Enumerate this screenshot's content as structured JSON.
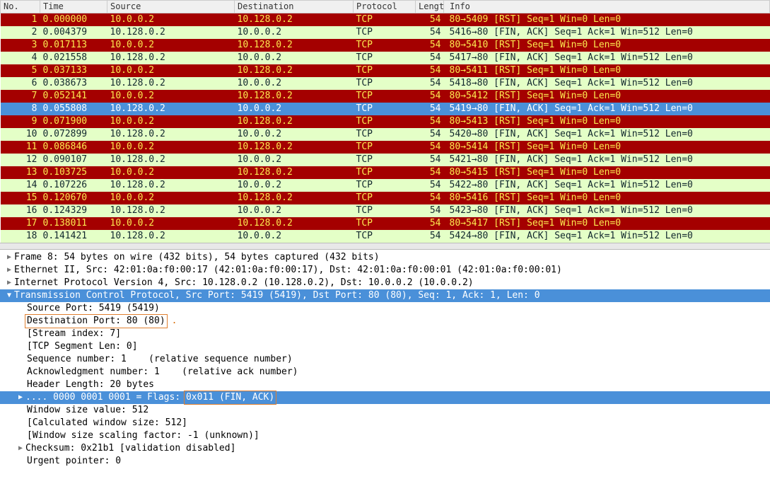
{
  "columns": {
    "no": "No.",
    "time": "Time",
    "src": "Source",
    "dst": "Destination",
    "proto": "Protocol",
    "len": "Length",
    "info": "Info"
  },
  "packets": [
    {
      "no": 1,
      "time": "0.000000",
      "src": "10.0.0.2",
      "dst": "10.128.0.2",
      "proto": "TCP",
      "len": 54,
      "info": "80→5409 [RST] Seq=1 Win=0 Len=0",
      "cls": "red"
    },
    {
      "no": 2,
      "time": "0.004379",
      "src": "10.128.0.2",
      "dst": "10.0.0.2",
      "proto": "TCP",
      "len": 54,
      "info": "5416→80 [FIN, ACK] Seq=1 Ack=1 Win=512 Len=0",
      "cls": "grn"
    },
    {
      "no": 3,
      "time": "0.017113",
      "src": "10.0.0.2",
      "dst": "10.128.0.2",
      "proto": "TCP",
      "len": 54,
      "info": "80→5410 [RST] Seq=1 Win=0 Len=0",
      "cls": "red"
    },
    {
      "no": 4,
      "time": "0.021558",
      "src": "10.128.0.2",
      "dst": "10.0.0.2",
      "proto": "TCP",
      "len": 54,
      "info": "5417→80 [FIN, ACK] Seq=1 Ack=1 Win=512 Len=0",
      "cls": "grn"
    },
    {
      "no": 5,
      "time": "0.037133",
      "src": "10.0.0.2",
      "dst": "10.128.0.2",
      "proto": "TCP",
      "len": 54,
      "info": "80→5411 [RST] Seq=1 Win=0 Len=0",
      "cls": "red"
    },
    {
      "no": 6,
      "time": "0.038673",
      "src": "10.128.0.2",
      "dst": "10.0.0.2",
      "proto": "TCP",
      "len": 54,
      "info": "5418→80 [FIN, ACK] Seq=1 Ack=1 Win=512 Len=0",
      "cls": "grn"
    },
    {
      "no": 7,
      "time": "0.052141",
      "src": "10.0.0.2",
      "dst": "10.128.0.2",
      "proto": "TCP",
      "len": 54,
      "info": "80→5412 [RST] Seq=1 Win=0 Len=0",
      "cls": "red"
    },
    {
      "no": 8,
      "time": "0.055808",
      "src": "10.128.0.2",
      "dst": "10.0.0.2",
      "proto": "TCP",
      "len": 54,
      "info": "5419→80 [FIN, ACK] Seq=1 Ack=1 Win=512 Len=0",
      "cls": "sel"
    },
    {
      "no": 9,
      "time": "0.071900",
      "src": "10.0.0.2",
      "dst": "10.128.0.2",
      "proto": "TCP",
      "len": 54,
      "info": "80→5413 [RST] Seq=1 Win=0 Len=0",
      "cls": "red"
    },
    {
      "no": 10,
      "time": "0.072899",
      "src": "10.128.0.2",
      "dst": "10.0.0.2",
      "proto": "TCP",
      "len": 54,
      "info": "5420→80 [FIN, ACK] Seq=1 Ack=1 Win=512 Len=0",
      "cls": "grn"
    },
    {
      "no": 11,
      "time": "0.086846",
      "src": "10.0.0.2",
      "dst": "10.128.0.2",
      "proto": "TCP",
      "len": 54,
      "info": "80→5414 [RST] Seq=1 Win=0 Len=0",
      "cls": "red"
    },
    {
      "no": 12,
      "time": "0.090107",
      "src": "10.128.0.2",
      "dst": "10.0.0.2",
      "proto": "TCP",
      "len": 54,
      "info": "5421→80 [FIN, ACK] Seq=1 Ack=1 Win=512 Len=0",
      "cls": "grn"
    },
    {
      "no": 13,
      "time": "0.103725",
      "src": "10.0.0.2",
      "dst": "10.128.0.2",
      "proto": "TCP",
      "len": 54,
      "info": "80→5415 [RST] Seq=1 Win=0 Len=0",
      "cls": "red"
    },
    {
      "no": 14,
      "time": "0.107226",
      "src": "10.128.0.2",
      "dst": "10.0.0.2",
      "proto": "TCP",
      "len": 54,
      "info": "5422→80 [FIN, ACK] Seq=1 Ack=1 Win=512 Len=0",
      "cls": "grn"
    },
    {
      "no": 15,
      "time": "0.120670",
      "src": "10.0.0.2",
      "dst": "10.128.0.2",
      "proto": "TCP",
      "len": 54,
      "info": "80→5416 [RST] Seq=1 Win=0 Len=0",
      "cls": "red"
    },
    {
      "no": 16,
      "time": "0.124329",
      "src": "10.128.0.2",
      "dst": "10.0.0.2",
      "proto": "TCP",
      "len": 54,
      "info": "5423→80 [FIN, ACK] Seq=1 Ack=1 Win=512 Len=0",
      "cls": "grn"
    },
    {
      "no": 17,
      "time": "0.138011",
      "src": "10.0.0.2",
      "dst": "10.128.0.2",
      "proto": "TCP",
      "len": 54,
      "info": "80→5417 [RST] Seq=1 Win=0 Len=0",
      "cls": "red"
    },
    {
      "no": 18,
      "time": "0.141421",
      "src": "10.128.0.2",
      "dst": "10.0.0.2",
      "proto": "TCP",
      "len": 54,
      "info": "5424→80 [FIN, ACK] Seq=1 Ack=1 Win=512 Len=0",
      "cls": "grn"
    }
  ],
  "tree": {
    "frame": "Frame 8: 54 bytes on wire (432 bits), 54 bytes captured (432 bits)",
    "eth": "Ethernet II, Src: 42:01:0a:f0:00:17 (42:01:0a:f0:00:17), Dst: 42:01:0a:f0:00:01 (42:01:0a:f0:00:01)",
    "ip": "Internet Protocol Version 4, Src: 10.128.0.2 (10.128.0.2), Dst: 10.0.0.2 (10.0.0.2)",
    "tcp_hdr": "Transmission Control Protocol, Src Port: 5419 (5419), Dst Port: 80 (80), Seq: 1, Ack: 1, Len: 0",
    "srcport": "Source Port: 5419 (5419)",
    "dstport": "Destination Port: 80 (80)",
    "stream": "[Stream index: 7]",
    "seglen": "[TCP Segment Len: 0]",
    "seq": "Sequence number: 1    (relative sequence number)",
    "ack": "Acknowledgment number: 1    (relative ack number)",
    "hdrlen": "Header Length: 20 bytes",
    "flags_pre": ".... 0000 0001 0001 = Flags: ",
    "flags_box": "0x011 (FIN, ACK)",
    "winsize": "Window size value: 512",
    "calcwin": "[Calculated window size: 512]",
    "winscale": "[Window size scaling factor: -1 (unknown)]",
    "cksum": "Checksum: 0x21b1 [validation disabled]",
    "urgent": "Urgent pointer: 0"
  }
}
